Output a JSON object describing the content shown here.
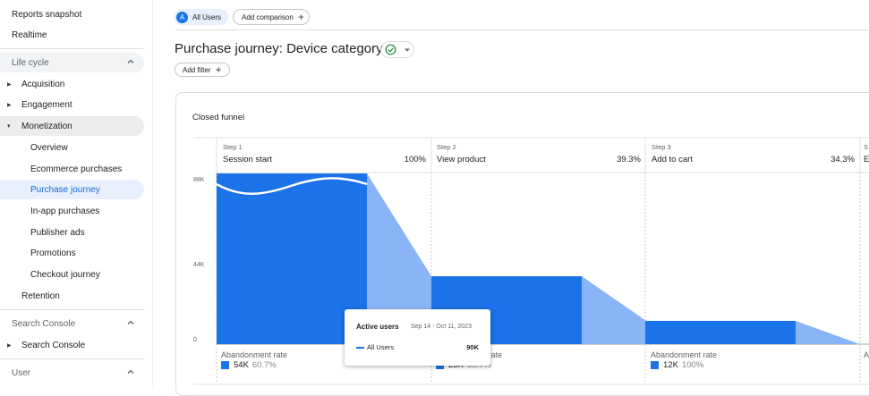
{
  "sidebar": {
    "top_items": [
      "Reports snapshot",
      "Realtime"
    ],
    "lifecycle": {
      "label": "Life cycle",
      "items": [
        {
          "label": "Acquisition"
        },
        {
          "label": "Engagement"
        },
        {
          "label": "Monetization"
        }
      ],
      "monetization_children": [
        "Overview",
        "Ecommerce purchases",
        "Purchase journey",
        "In-app purchases",
        "Publisher ads",
        "Promotions",
        "Checkout journey"
      ],
      "after": "Retention"
    },
    "search_console": {
      "label": "Search Console",
      "items": [
        "Search Console"
      ]
    },
    "user": {
      "label": "User"
    }
  },
  "header": {
    "segment_badge": "A",
    "segment_label": "All Users",
    "compare_label": "Add comparison",
    "title": "Purchase journey: Device category",
    "filter_label": "Add filter"
  },
  "card": {
    "title": "Closed funnel"
  },
  "chart_data": {
    "type": "bar",
    "title": "Closed funnel",
    "y_ticks": [
      "88K",
      "44K",
      "0"
    ],
    "ylim": [
      0,
      88000
    ],
    "steps": [
      {
        "step": "Step 1",
        "name": "Session start",
        "pct": "100%",
        "value": 88000,
        "abandon_label": "Abandonment rate",
        "abandon_count": "54K",
        "abandon_rate": "60.7%"
      },
      {
        "step": "Step 2",
        "name": "View product",
        "pct": "39.3%",
        "value": 35000,
        "abandon_label": "Abandonment rate",
        "abandon_count": "23K",
        "abandon_rate": "65.7%"
      },
      {
        "step": "Step 3",
        "name": "Add to cart",
        "pct": "34.3%",
        "value": 12000,
        "abandon_label": "Abandonment rate",
        "abandon_count": "12K",
        "abandon_rate": "100%"
      },
      {
        "step": "S",
        "name": "E",
        "pct": "",
        "value": 0,
        "abandon_label": "A",
        "abandon_count": "",
        "abandon_rate": ""
      }
    ],
    "colors": {
      "bar": "#1a73e8",
      "abandon": "#8ab4f8",
      "grid": "#e0e0e0"
    }
  },
  "tooltip": {
    "title": "Active users",
    "range": "Sep 14 - Oct 11, 2023",
    "series": "All Users",
    "value": "90K"
  }
}
